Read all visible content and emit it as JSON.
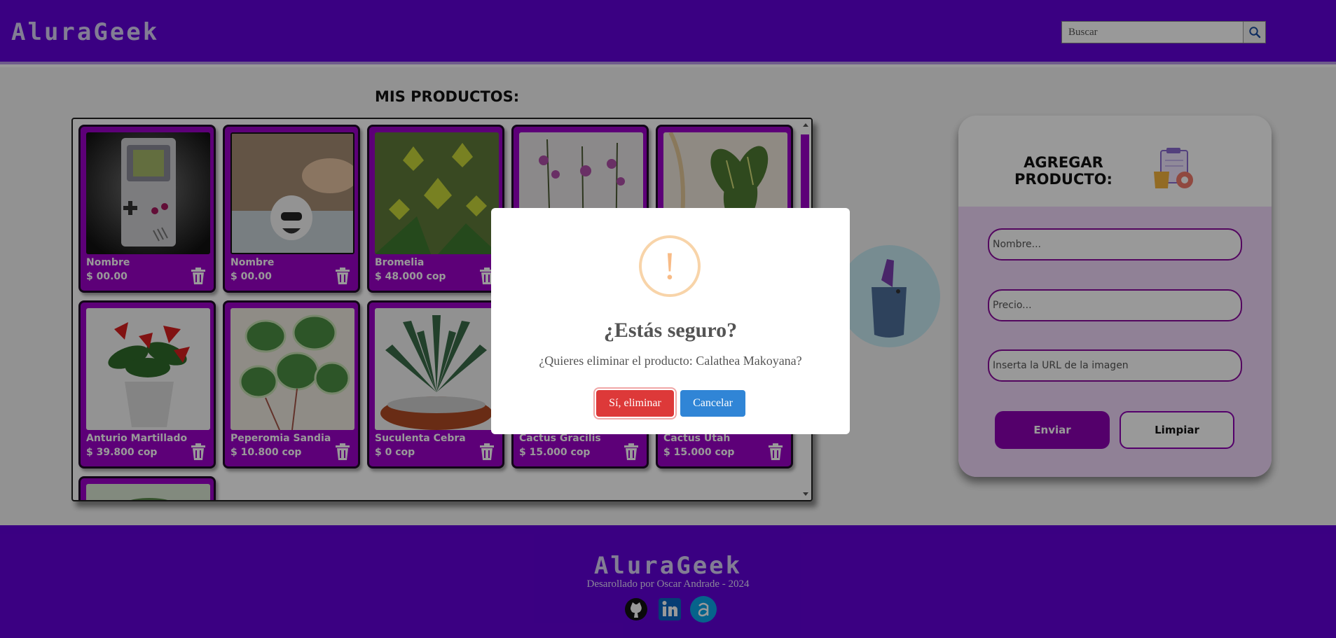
{
  "brand": {
    "logo": "AluraGeek"
  },
  "search": {
    "placeholder": "Buscar",
    "icon": "search-icon"
  },
  "main": {
    "title": "MIS PRODUCTOS:"
  },
  "products": [
    {
      "name": "Nombre",
      "price": "$ 00.00"
    },
    {
      "name": "Nombre",
      "price": "$ 00.00"
    },
    {
      "name": "Bromelia",
      "price": "$ 48.000 cop"
    },
    {
      "name": "",
      "price": ""
    },
    {
      "name": "",
      "price": ""
    },
    {
      "name": "Anturio Martillado",
      "price": "$ 39.800 cop"
    },
    {
      "name": "Peperomia Sandia",
      "price": "$ 10.800 cop"
    },
    {
      "name": "Suculenta Cebra",
      "price": "$ 0 cop"
    },
    {
      "name": "Cactus Gracilis",
      "price": "$ 15.000 cop"
    },
    {
      "name": "Cactus Utah",
      "price": "$ 15.000 cop"
    },
    {
      "name": "",
      "price": ""
    }
  ],
  "form": {
    "title": "AGREGAR PRODUCTO:",
    "name_placeholder": "Nombre...",
    "price_placeholder": "Precio...",
    "url_placeholder": "Inserta la URL de la imagen",
    "send_label": "Enviar",
    "clear_label": "Limpiar"
  },
  "footer": {
    "logo": "AluraGeek",
    "credit": "Desarollado por Oscar Andrade - 2024",
    "social_icons": [
      "github-icon",
      "linkedin-icon",
      "alura-icon"
    ]
  },
  "modal": {
    "icon_glyph": "!",
    "title": "¿Estás seguro?",
    "text": "¿Quieres eliminar el producto: Calathea Makoyana?",
    "confirm_label": "Sí, eliminar",
    "cancel_label": "Cancelar"
  },
  "colors": {
    "primary": "#6200d9",
    "card": "#9b00c8",
    "form_bg": "#f0d8fa",
    "confirm": "#dd3939",
    "cancel": "#3085d6",
    "warning": "#f8bb86"
  }
}
